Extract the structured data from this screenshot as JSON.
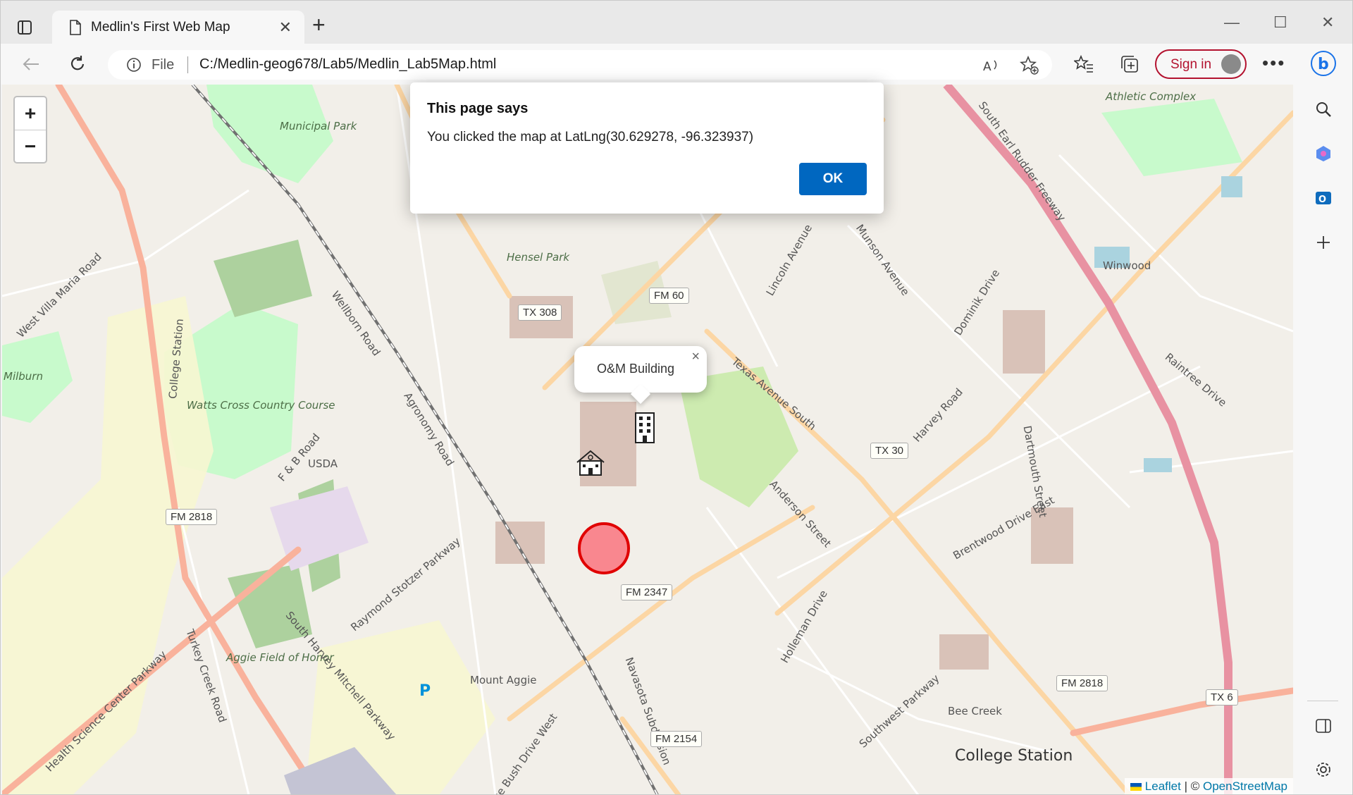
{
  "browser": {
    "tab_title": "Medlin's First Web Map",
    "address_scheme": "File",
    "url": "C:/Medlin-geog678/Lab5/Medlin_Lab5Map.html",
    "signin_label": "Sign in"
  },
  "dialog": {
    "heading": "This page says",
    "message": "You clicked the map at LatLng(30.629278, -96.323937)",
    "ok_label": "OK"
  },
  "map": {
    "zoom_in": "+",
    "zoom_out": "−",
    "popup_text": "O&M Building",
    "popup_close": "×",
    "attribution": {
      "leaflet": "Leaflet",
      "separator": "| ©",
      "osm": "OpenStreetMap"
    },
    "labels": {
      "municipal_park": "Municipal Park",
      "hensel_park": "Hensel Park",
      "watts_cross": "Watts Cross Country Course",
      "usda": "USDA",
      "aggie_field": "Aggie Field of Honor",
      "mount_aggie": "Mount Aggie",
      "athletic_complex": "Athletic Complex",
      "winwood": "Winwood",
      "milburn": "Milburn",
      "bee_creek": "Bee Creek",
      "college_station": "College Station",
      "parking": "P",
      "wellborn_road": "Wellborn Road",
      "texas_avenue": "Texas Avenue South",
      "earl_rudder": "South Earl Rudder Freeway",
      "harvey_mitchell": "South Harvey Mitchell Parkway",
      "raymond_stotzer": "Raymond Stotzer Parkway",
      "anderson_street": "Anderson Street",
      "holleman_drive": "Holleman Drive",
      "harvey_road": "Harvey Road",
      "southwest_parkway": "Southwest Parkway",
      "george_bush": "George Bush Drive West",
      "agronomy_road": "Agronomy Road",
      "fb_road": "F & B Road",
      "college_station_road": "College Station",
      "west_villa_maria": "West Villa Maria Road",
      "dominik_drive": "Dominik Drive",
      "munson_avenue": "Munson Avenue",
      "lincoln_avenue": "Lincoln Avenue",
      "raintree_drive": "Raintree Drive",
      "turkey_creek": "Turkey Creek Road",
      "health_science": "Health Science Center Parkway",
      "navasota": "Navasota Subdivision",
      "dartmouth": "Dartmouth Street",
      "brentwood": "Brentwood Drive East"
    },
    "shields": {
      "tx308": "TX 308",
      "fm60": "FM 60",
      "tx30": "TX 30",
      "fm2818_a": "FM 2818",
      "fm2347": "FM 2347",
      "fm2154": "FM 2154",
      "fm2818_b": "FM 2818",
      "tx6": "TX 6"
    }
  },
  "colors": {
    "map_bg": "#f2efe9",
    "primary_road": "#fcd6a4",
    "trunk": "#f9b29c",
    "motorway": "#e892a2",
    "park": "#c8facc",
    "marker": "#ff0000",
    "accent": "#0067c0"
  }
}
